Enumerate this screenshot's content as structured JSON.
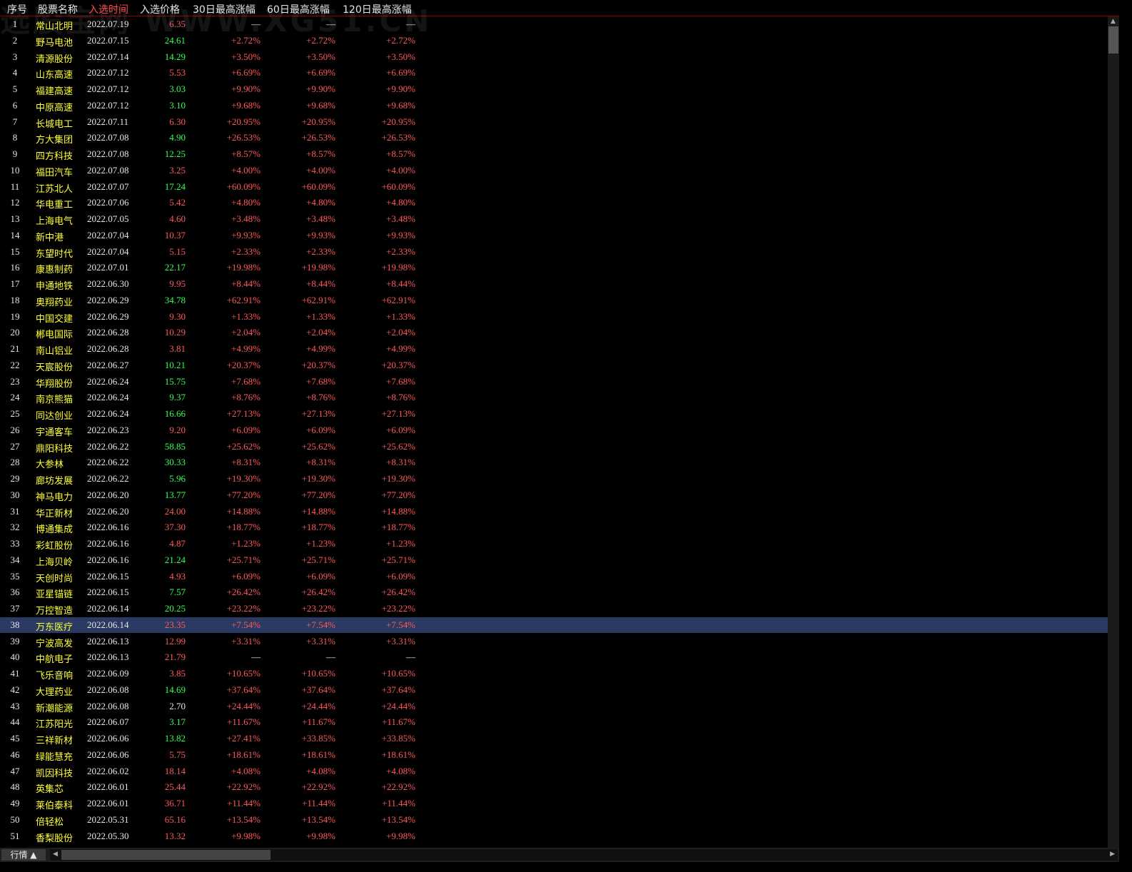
{
  "watermark": "选股宝网 WWW.XG51.CN",
  "headers": [
    "序号",
    "股票名称",
    "入选时间",
    "入选价格",
    "30日最高涨幅",
    "60日最高涨幅",
    "120日最高涨幅"
  ],
  "active_header_index": 2,
  "colors": {
    "up": "#ff5a5a",
    "down": "#33ff55",
    "name": "#ffff33",
    "neutral": "#e6e6e6",
    "selected_row": "#2a3a62"
  },
  "selected_row": 38,
  "rows": [
    {
      "idx": "1",
      "name": "常山北明",
      "date": "2022.07.19",
      "price": "6.35",
      "pc": "up",
      "p30": "—",
      "p60": "—",
      "p120": "—"
    },
    {
      "idx": "2",
      "name": "野马电池",
      "date": "2022.07.15",
      "price": "24.61",
      "pc": "down",
      "p30": "+2.72%",
      "p60": "+2.72%",
      "p120": "+2.72%"
    },
    {
      "idx": "3",
      "name": "清源股份",
      "date": "2022.07.14",
      "price": "14.29",
      "pc": "down",
      "p30": "+3.50%",
      "p60": "+3.50%",
      "p120": "+3.50%"
    },
    {
      "idx": "4",
      "name": "山东高速",
      "date": "2022.07.12",
      "price": "5.53",
      "pc": "up",
      "p30": "+6.69%",
      "p60": "+6.69%",
      "p120": "+6.69%"
    },
    {
      "idx": "5",
      "name": "福建高速",
      "date": "2022.07.12",
      "price": "3.03",
      "pc": "down",
      "p30": "+9.90%",
      "p60": "+9.90%",
      "p120": "+9.90%"
    },
    {
      "idx": "6",
      "name": "中原高速",
      "date": "2022.07.12",
      "price": "3.10",
      "pc": "down",
      "p30": "+9.68%",
      "p60": "+9.68%",
      "p120": "+9.68%"
    },
    {
      "idx": "7",
      "name": "长城电工",
      "date": "2022.07.11",
      "price": "6.30",
      "pc": "up",
      "p30": "+20.95%",
      "p60": "+20.95%",
      "p120": "+20.95%"
    },
    {
      "idx": "8",
      "name": "方大集团",
      "date": "2022.07.08",
      "price": "4.90",
      "pc": "down",
      "p30": "+26.53%",
      "p60": "+26.53%",
      "p120": "+26.53%"
    },
    {
      "idx": "9",
      "name": "四方科技",
      "date": "2022.07.08",
      "price": "12.25",
      "pc": "down",
      "p30": "+8.57%",
      "p60": "+8.57%",
      "p120": "+8.57%"
    },
    {
      "idx": "10",
      "name": "福田汽车",
      "date": "2022.07.08",
      "price": "3.25",
      "pc": "up",
      "p30": "+4.00%",
      "p60": "+4.00%",
      "p120": "+4.00%"
    },
    {
      "idx": "11",
      "name": "江苏北人",
      "date": "2022.07.07",
      "price": "17.24",
      "pc": "down",
      "p30": "+60.09%",
      "p60": "+60.09%",
      "p120": "+60.09%"
    },
    {
      "idx": "12",
      "name": "华电重工",
      "date": "2022.07.06",
      "price": "5.42",
      "pc": "up",
      "p30": "+4.80%",
      "p60": "+4.80%",
      "p120": "+4.80%"
    },
    {
      "idx": "13",
      "name": "上海电气",
      "date": "2022.07.05",
      "price": "4.60",
      "pc": "up",
      "p30": "+3.48%",
      "p60": "+3.48%",
      "p120": "+3.48%"
    },
    {
      "idx": "14",
      "name": "新中港",
      "date": "2022.07.04",
      "price": "10.37",
      "pc": "up",
      "p30": "+9.93%",
      "p60": "+9.93%",
      "p120": "+9.93%"
    },
    {
      "idx": "15",
      "name": "东望时代",
      "date": "2022.07.04",
      "price": "5.15",
      "pc": "up",
      "p30": "+2.33%",
      "p60": "+2.33%",
      "p120": "+2.33%"
    },
    {
      "idx": "16",
      "name": "康惠制药",
      "date": "2022.07.01",
      "price": "22.17",
      "pc": "down",
      "p30": "+19.98%",
      "p60": "+19.98%",
      "p120": "+19.98%"
    },
    {
      "idx": "17",
      "name": "申通地铁",
      "date": "2022.06.30",
      "price": "9.95",
      "pc": "up",
      "p30": "+8.44%",
      "p60": "+8.44%",
      "p120": "+8.44%"
    },
    {
      "idx": "18",
      "name": "奥翔药业",
      "date": "2022.06.29",
      "price": "34.78",
      "pc": "down",
      "p30": "+62.91%",
      "p60": "+62.91%",
      "p120": "+62.91%"
    },
    {
      "idx": "19",
      "name": "中国交建",
      "date": "2022.06.29",
      "price": "9.30",
      "pc": "up",
      "p30": "+1.33%",
      "p60": "+1.33%",
      "p120": "+1.33%"
    },
    {
      "idx": "20",
      "name": "郴电国际",
      "date": "2022.06.28",
      "price": "10.29",
      "pc": "up",
      "p30": "+2.04%",
      "p60": "+2.04%",
      "p120": "+2.04%"
    },
    {
      "idx": "21",
      "name": "南山铝业",
      "date": "2022.06.28",
      "price": "3.81",
      "pc": "up",
      "p30": "+4.99%",
      "p60": "+4.99%",
      "p120": "+4.99%"
    },
    {
      "idx": "22",
      "name": "天宸股份",
      "date": "2022.06.27",
      "price": "10.21",
      "pc": "down",
      "p30": "+20.37%",
      "p60": "+20.37%",
      "p120": "+20.37%"
    },
    {
      "idx": "23",
      "name": "华翔股份",
      "date": "2022.06.24",
      "price": "15.75",
      "pc": "down",
      "p30": "+7.68%",
      "p60": "+7.68%",
      "p120": "+7.68%"
    },
    {
      "idx": "24",
      "name": "南京熊猫",
      "date": "2022.06.24",
      "price": "9.37",
      "pc": "down",
      "p30": "+8.76%",
      "p60": "+8.76%",
      "p120": "+8.76%"
    },
    {
      "idx": "25",
      "name": "同达创业",
      "date": "2022.06.24",
      "price": "16.66",
      "pc": "down",
      "p30": "+27.13%",
      "p60": "+27.13%",
      "p120": "+27.13%"
    },
    {
      "idx": "26",
      "name": "宇通客车",
      "date": "2022.06.23",
      "price": "9.20",
      "pc": "up",
      "p30": "+6.09%",
      "p60": "+6.09%",
      "p120": "+6.09%"
    },
    {
      "idx": "27",
      "name": "鼎阳科技",
      "date": "2022.06.22",
      "price": "58.85",
      "pc": "down",
      "p30": "+25.62%",
      "p60": "+25.62%",
      "p120": "+25.62%"
    },
    {
      "idx": "28",
      "name": "大参林",
      "date": "2022.06.22",
      "price": "30.33",
      "pc": "down",
      "p30": "+8.31%",
      "p60": "+8.31%",
      "p120": "+8.31%"
    },
    {
      "idx": "29",
      "name": "廊坊发展",
      "date": "2022.06.22",
      "price": "5.96",
      "pc": "down",
      "p30": "+19.30%",
      "p60": "+19.30%",
      "p120": "+19.30%"
    },
    {
      "idx": "30",
      "name": "神马电力",
      "date": "2022.06.20",
      "price": "13.77",
      "pc": "down",
      "p30": "+77.20%",
      "p60": "+77.20%",
      "p120": "+77.20%"
    },
    {
      "idx": "31",
      "name": "华正新材",
      "date": "2022.06.20",
      "price": "24.00",
      "pc": "up",
      "p30": "+14.88%",
      "p60": "+14.88%",
      "p120": "+14.88%"
    },
    {
      "idx": "32",
      "name": "博通集成",
      "date": "2022.06.16",
      "price": "37.30",
      "pc": "up",
      "p30": "+18.77%",
      "p60": "+18.77%",
      "p120": "+18.77%"
    },
    {
      "idx": "33",
      "name": "彩虹股份",
      "date": "2022.06.16",
      "price": "4.87",
      "pc": "up",
      "p30": "+1.23%",
      "p60": "+1.23%",
      "p120": "+1.23%"
    },
    {
      "idx": "34",
      "name": "上海贝岭",
      "date": "2022.06.16",
      "price": "21.24",
      "pc": "down",
      "p30": "+25.71%",
      "p60": "+25.71%",
      "p120": "+25.71%"
    },
    {
      "idx": "35",
      "name": "天创时尚",
      "date": "2022.06.15",
      "price": "4.93",
      "pc": "up",
      "p30": "+6.09%",
      "p60": "+6.09%",
      "p120": "+6.09%"
    },
    {
      "idx": "36",
      "name": "亚星锚链",
      "date": "2022.06.15",
      "price": "7.57",
      "pc": "down",
      "p30": "+26.42%",
      "p60": "+26.42%",
      "p120": "+26.42%"
    },
    {
      "idx": "37",
      "name": "万控智造",
      "date": "2022.06.14",
      "price": "20.25",
      "pc": "down",
      "p30": "+23.22%",
      "p60": "+23.22%",
      "p120": "+23.22%"
    },
    {
      "idx": "38",
      "name": "万东医疗",
      "date": "2022.06.14",
      "price": "23.35",
      "pc": "up",
      "p30": "+7.54%",
      "p60": "+7.54%",
      "p120": "+7.54%"
    },
    {
      "idx": "39",
      "name": "宁波高发",
      "date": "2022.06.13",
      "price": "12.99",
      "pc": "up",
      "p30": "+3.31%",
      "p60": "+3.31%",
      "p120": "+3.31%"
    },
    {
      "idx": "40",
      "name": "中航电子",
      "date": "2022.06.13",
      "price": "21.79",
      "pc": "up",
      "p30": "—",
      "p60": "—",
      "p120": "—"
    },
    {
      "idx": "41",
      "name": "飞乐音响",
      "date": "2022.06.09",
      "price": "3.85",
      "pc": "up",
      "p30": "+10.65%",
      "p60": "+10.65%",
      "p120": "+10.65%"
    },
    {
      "idx": "42",
      "name": "大理药业",
      "date": "2022.06.08",
      "price": "14.69",
      "pc": "down",
      "p30": "+37.64%",
      "p60": "+37.64%",
      "p120": "+37.64%"
    },
    {
      "idx": "43",
      "name": "新潮能源",
      "date": "2022.06.08",
      "price": "2.70",
      "pc": "neutral",
      "p30": "+24.44%",
      "p60": "+24.44%",
      "p120": "+24.44%"
    },
    {
      "idx": "44",
      "name": "江苏阳光",
      "date": "2022.06.07",
      "price": "3.17",
      "pc": "down",
      "p30": "+11.67%",
      "p60": "+11.67%",
      "p120": "+11.67%"
    },
    {
      "idx": "45",
      "name": "三祥新材",
      "date": "2022.06.06",
      "price": "13.82",
      "pc": "down",
      "p30": "+27.41%",
      "p60": "+33.85%",
      "p120": "+33.85%"
    },
    {
      "idx": "46",
      "name": "绿能慧充",
      "date": "2022.06.06",
      "price": "5.75",
      "pc": "up",
      "p30": "+18.61%",
      "p60": "+18.61%",
      "p120": "+18.61%"
    },
    {
      "idx": "47",
      "name": "凯因科技",
      "date": "2022.06.02",
      "price": "18.14",
      "pc": "up",
      "p30": "+4.08%",
      "p60": "+4.08%",
      "p120": "+4.08%"
    },
    {
      "idx": "48",
      "name": "英集芯",
      "date": "2022.06.01",
      "price": "25.44",
      "pc": "up",
      "p30": "+22.92%",
      "p60": "+22.92%",
      "p120": "+22.92%"
    },
    {
      "idx": "49",
      "name": "莱伯泰科",
      "date": "2022.06.01",
      "price": "36.71",
      "pc": "up",
      "p30": "+11.44%",
      "p60": "+11.44%",
      "p120": "+11.44%"
    },
    {
      "idx": "50",
      "name": "倍轻松",
      "date": "2022.05.31",
      "price": "65.16",
      "pc": "up",
      "p30": "+13.54%",
      "p60": "+13.54%",
      "p120": "+13.54%"
    },
    {
      "idx": "51",
      "name": "香梨股份",
      "date": "2022.05.30",
      "price": "13.32",
      "pc": "up",
      "p30": "+9.98%",
      "p60": "+9.98%",
      "p120": "+9.98%"
    }
  ],
  "footer": {
    "tab_label": "行情 ▲"
  }
}
